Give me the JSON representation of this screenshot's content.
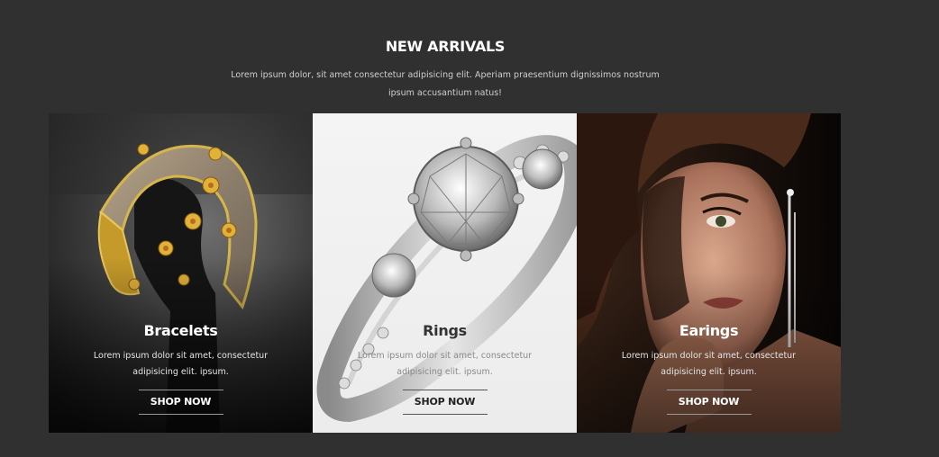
{
  "section": {
    "heading": "NEW ARRIVALS",
    "intro": "Lorem ipsum dolor, sit amet consectetur adipisicing elit. Aperiam praesentium dignissimos nostrum ipsum accusantium natus!"
  },
  "cards": [
    {
      "title": "Bracelets",
      "description": "Lorem ipsum dolor sit amet, consectetur adipisicing elit. ipsum.",
      "button": "SHOP NOW"
    },
    {
      "title": "Rings",
      "description": "Lorem ipsum dolor sit amet, consectetur adipisicing elit. ipsum.",
      "button": "SHOP NOW"
    },
    {
      "title": "Earings",
      "description": "Lorem ipsum dolor sit amet, consectetur adipisicing elit. ipsum.",
      "button": "SHOP NOW"
    }
  ],
  "colors": {
    "page_background": "#303030",
    "heading_text": "#ffffff"
  }
}
